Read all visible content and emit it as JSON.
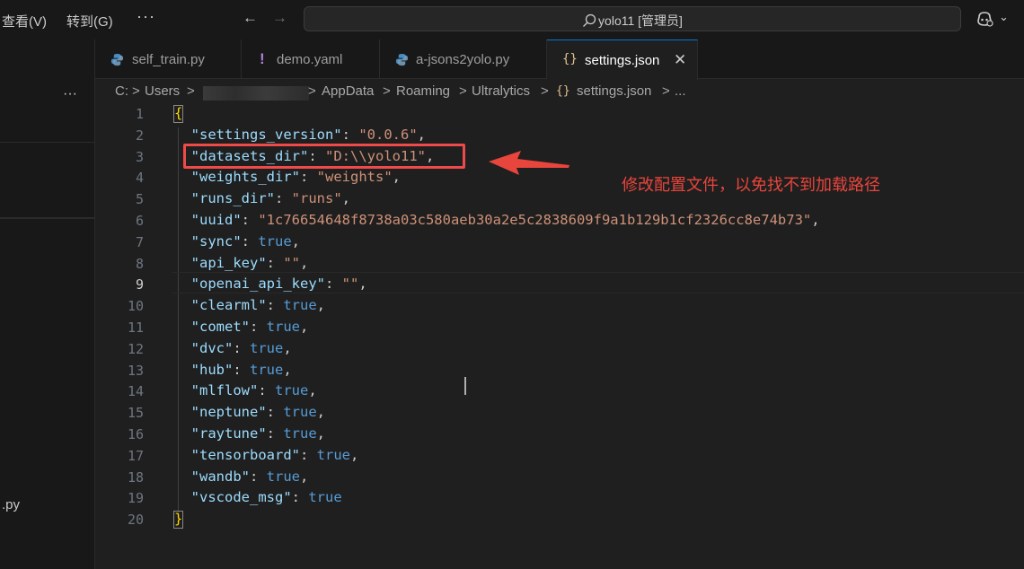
{
  "menubar": {
    "view": "查看(V)",
    "goto": "转到(G)",
    "more": "···"
  },
  "nav": {
    "back": "←",
    "forward": "→"
  },
  "search": {
    "text": "yolo11 [管理员]"
  },
  "sidebar": {
    "more": "···",
    "file_fragment": ".py"
  },
  "tabs": [
    {
      "label": "self_train.py",
      "icon": "python-icon",
      "active": false
    },
    {
      "label": "demo.yaml",
      "icon": "yaml-exclamation-icon",
      "active": false
    },
    {
      "label": "a-jsons2yolo.py",
      "icon": "python-icon",
      "active": false
    },
    {
      "label": "settings.json",
      "icon": "json-braces-icon",
      "active": true,
      "close": "✕"
    }
  ],
  "breadcrumb": {
    "c": "C:",
    "users": "Users",
    "appdata": "AppData",
    "roaming": "Roaming",
    "ultralytics": "Ultralytics",
    "file": "settings.json",
    "ellipsis": "...",
    "sep": ">"
  },
  "editor": {
    "line_numbers": [
      "1",
      "2",
      "3",
      "4",
      "5",
      "6",
      "7",
      "8",
      "9",
      "10",
      "11",
      "12",
      "13",
      "14",
      "15",
      "16",
      "17",
      "18",
      "19",
      "20"
    ],
    "current_line": 9,
    "lines": [
      {
        "brace": "{"
      },
      {
        "key": "\"settings_version\"",
        "sep": ": ",
        "val": "\"0.0.6\"",
        "vtype": "s",
        "end": ","
      },
      {
        "key": "\"datasets_dir\"",
        "sep": ": ",
        "val": "\"D:\\\\yolo11\"",
        "vtype": "s",
        "end": ","
      },
      {
        "key": "\"weights_dir\"",
        "sep": ": ",
        "val": "\"weights\"",
        "vtype": "s",
        "end": ","
      },
      {
        "key": "\"runs_dir\"",
        "sep": ": ",
        "val": "\"runs\"",
        "vtype": "s",
        "end": ","
      },
      {
        "key": "\"uuid\"",
        "sep": ": ",
        "val": "\"1c76654648f8738a03c580aeb30a2e5c2838609f9a1b129b1cf2326cc8e74b73\"",
        "vtype": "s",
        "end": ","
      },
      {
        "key": "\"sync\"",
        "sep": ": ",
        "val": "true",
        "vtype": "b",
        "end": ","
      },
      {
        "key": "\"api_key\"",
        "sep": ": ",
        "val": "\"\"",
        "vtype": "s",
        "end": ","
      },
      {
        "key": "\"openai_api_key\"",
        "sep": ": ",
        "val": "\"\"",
        "vtype": "s",
        "end": ","
      },
      {
        "key": "\"clearml\"",
        "sep": ": ",
        "val": "true",
        "vtype": "b",
        "end": ","
      },
      {
        "key": "\"comet\"",
        "sep": ": ",
        "val": "true",
        "vtype": "b",
        "end": ","
      },
      {
        "key": "\"dvc\"",
        "sep": ": ",
        "val": "true",
        "vtype": "b",
        "end": ","
      },
      {
        "key": "\"hub\"",
        "sep": ": ",
        "val": "true",
        "vtype": "b",
        "end": ","
      },
      {
        "key": "\"mlflow\"",
        "sep": ": ",
        "val": "true",
        "vtype": "b",
        "end": ","
      },
      {
        "key": "\"neptune\"",
        "sep": ": ",
        "val": "true",
        "vtype": "b",
        "end": ","
      },
      {
        "key": "\"raytune\"",
        "sep": ": ",
        "val": "true",
        "vtype": "b",
        "end": ","
      },
      {
        "key": "\"tensorboard\"",
        "sep": ": ",
        "val": "true",
        "vtype": "b",
        "end": ","
      },
      {
        "key": "\"wandb\"",
        "sep": ": ",
        "val": "true",
        "vtype": "b",
        "end": ","
      },
      {
        "key": "\"vscode_msg\"",
        "sep": ": ",
        "val": "true",
        "vtype": "b",
        "end": ""
      },
      {
        "brace": "}"
      }
    ]
  },
  "annotation": {
    "text": "修改配置文件，以免找不到加载路径"
  },
  "colors": {
    "annotation": "#e8453c",
    "json_key": "#9cdcfe",
    "json_string": "#ce9178",
    "json_bool": "#569cd6",
    "brace": "#ffd700"
  }
}
